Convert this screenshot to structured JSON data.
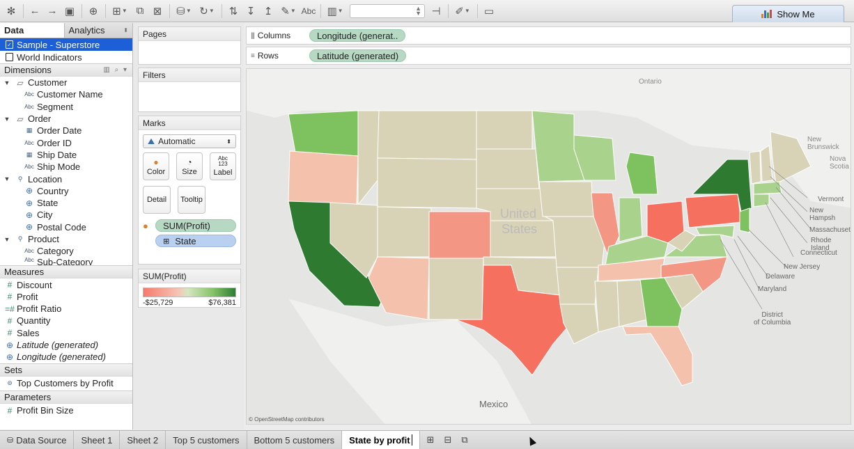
{
  "toolbar": {
    "format_label": "Abc",
    "show_me_label": "Show Me",
    "colors": {
      "show_me_bar1": "#d9822b",
      "show_me_bar2": "#3a6fb5",
      "show_me_bar3": "#4e9a4e",
      "show_me_bar4": "#c94c4c"
    }
  },
  "data_pane": {
    "tabs": [
      "Data",
      "Analytics"
    ],
    "data_sources": [
      {
        "label": "Sample - Superstore",
        "selected": true
      },
      {
        "label": "World Indicators",
        "selected": false
      }
    ],
    "dimensions_header": "Dimensions",
    "dimensions": {
      "customer": {
        "label": "Customer",
        "fields": [
          "Customer Name",
          "Segment"
        ]
      },
      "order": {
        "label": "Order",
        "fields": [
          "Order Date",
          "Order ID",
          "Ship Date",
          "Ship Mode"
        ]
      },
      "location": {
        "label": "Location",
        "fields": [
          "Country",
          "State",
          "City",
          "Postal Code"
        ]
      },
      "product": {
        "label": "Product",
        "fields": [
          "Category",
          "Sub-Category"
        ]
      }
    },
    "measures_header": "Measures",
    "measures": [
      "Discount",
      "Profit",
      "Profit Ratio",
      "Quantity",
      "Sales",
      "Latitude (generated)",
      "Longitude (generated)"
    ],
    "sets_header": "Sets",
    "sets": [
      "Top Customers by Profit"
    ],
    "parameters_header": "Parameters",
    "parameters": [
      "Profit Bin Size"
    ]
  },
  "cards": {
    "pages_title": "Pages",
    "filters_title": "Filters",
    "marks_title": "Marks",
    "mark_type": "Automatic",
    "mark_buttons": {
      "color": "Color",
      "size": "Size",
      "label": "Label",
      "label_icon_top": "Abc",
      "label_icon_bottom": "123",
      "detail": "Detail",
      "tooltip": "Tooltip"
    },
    "marks_pills": {
      "color_pill": "SUM(Profit)",
      "detail_pill": "State"
    },
    "legend": {
      "title": "SUM(Profit)",
      "min": "-$25,729",
      "max": "$76,381"
    }
  },
  "shelves": {
    "columns_label": "Columns",
    "columns_pill": "Longitude (generat..",
    "rows_label": "Rows",
    "rows_pill": "Latitude (generated)"
  },
  "map": {
    "labels": {
      "ontario": "Ontario",
      "united": "United",
      "states": "States",
      "mexico": "Mexico",
      "new_brunswick_1": "New",
      "new_brunswick_2": "Brunswick",
      "nova_scotia_1": "Nova",
      "nova_scotia_2": "Scotia",
      "vermont": "Vermont",
      "new_hampshire": "New Hampsh",
      "massachusetts": "Massachusetts",
      "rhode_island": "Rhode Island",
      "connecticut": "Connecticut",
      "new_jersey": "New Jersey",
      "delaware": "Delaware",
      "maryland": "Maryland",
      "dc_1": "District",
      "dc_2": "of Columbia"
    },
    "copyright": "© OpenStreetMap contributors",
    "colors": {
      "water": "#e5e5e3",
      "land": "#f0f0ee",
      "neutral": "#d8d3b6",
      "light_green": "#a9d38c",
      "mid_green": "#7ec25f",
      "dark_green": "#3a8f3c",
      "darkest_green": "#2d7a30",
      "light_red": "#f3c1ac",
      "mid_red": "#f39784",
      "strong_red": "#f6705f"
    }
  },
  "sheet_tabs": [
    "Data Source",
    "Sheet 1",
    "Sheet 2",
    "Top 5 customers",
    "Bottom 5 customers",
    "State by profit"
  ]
}
